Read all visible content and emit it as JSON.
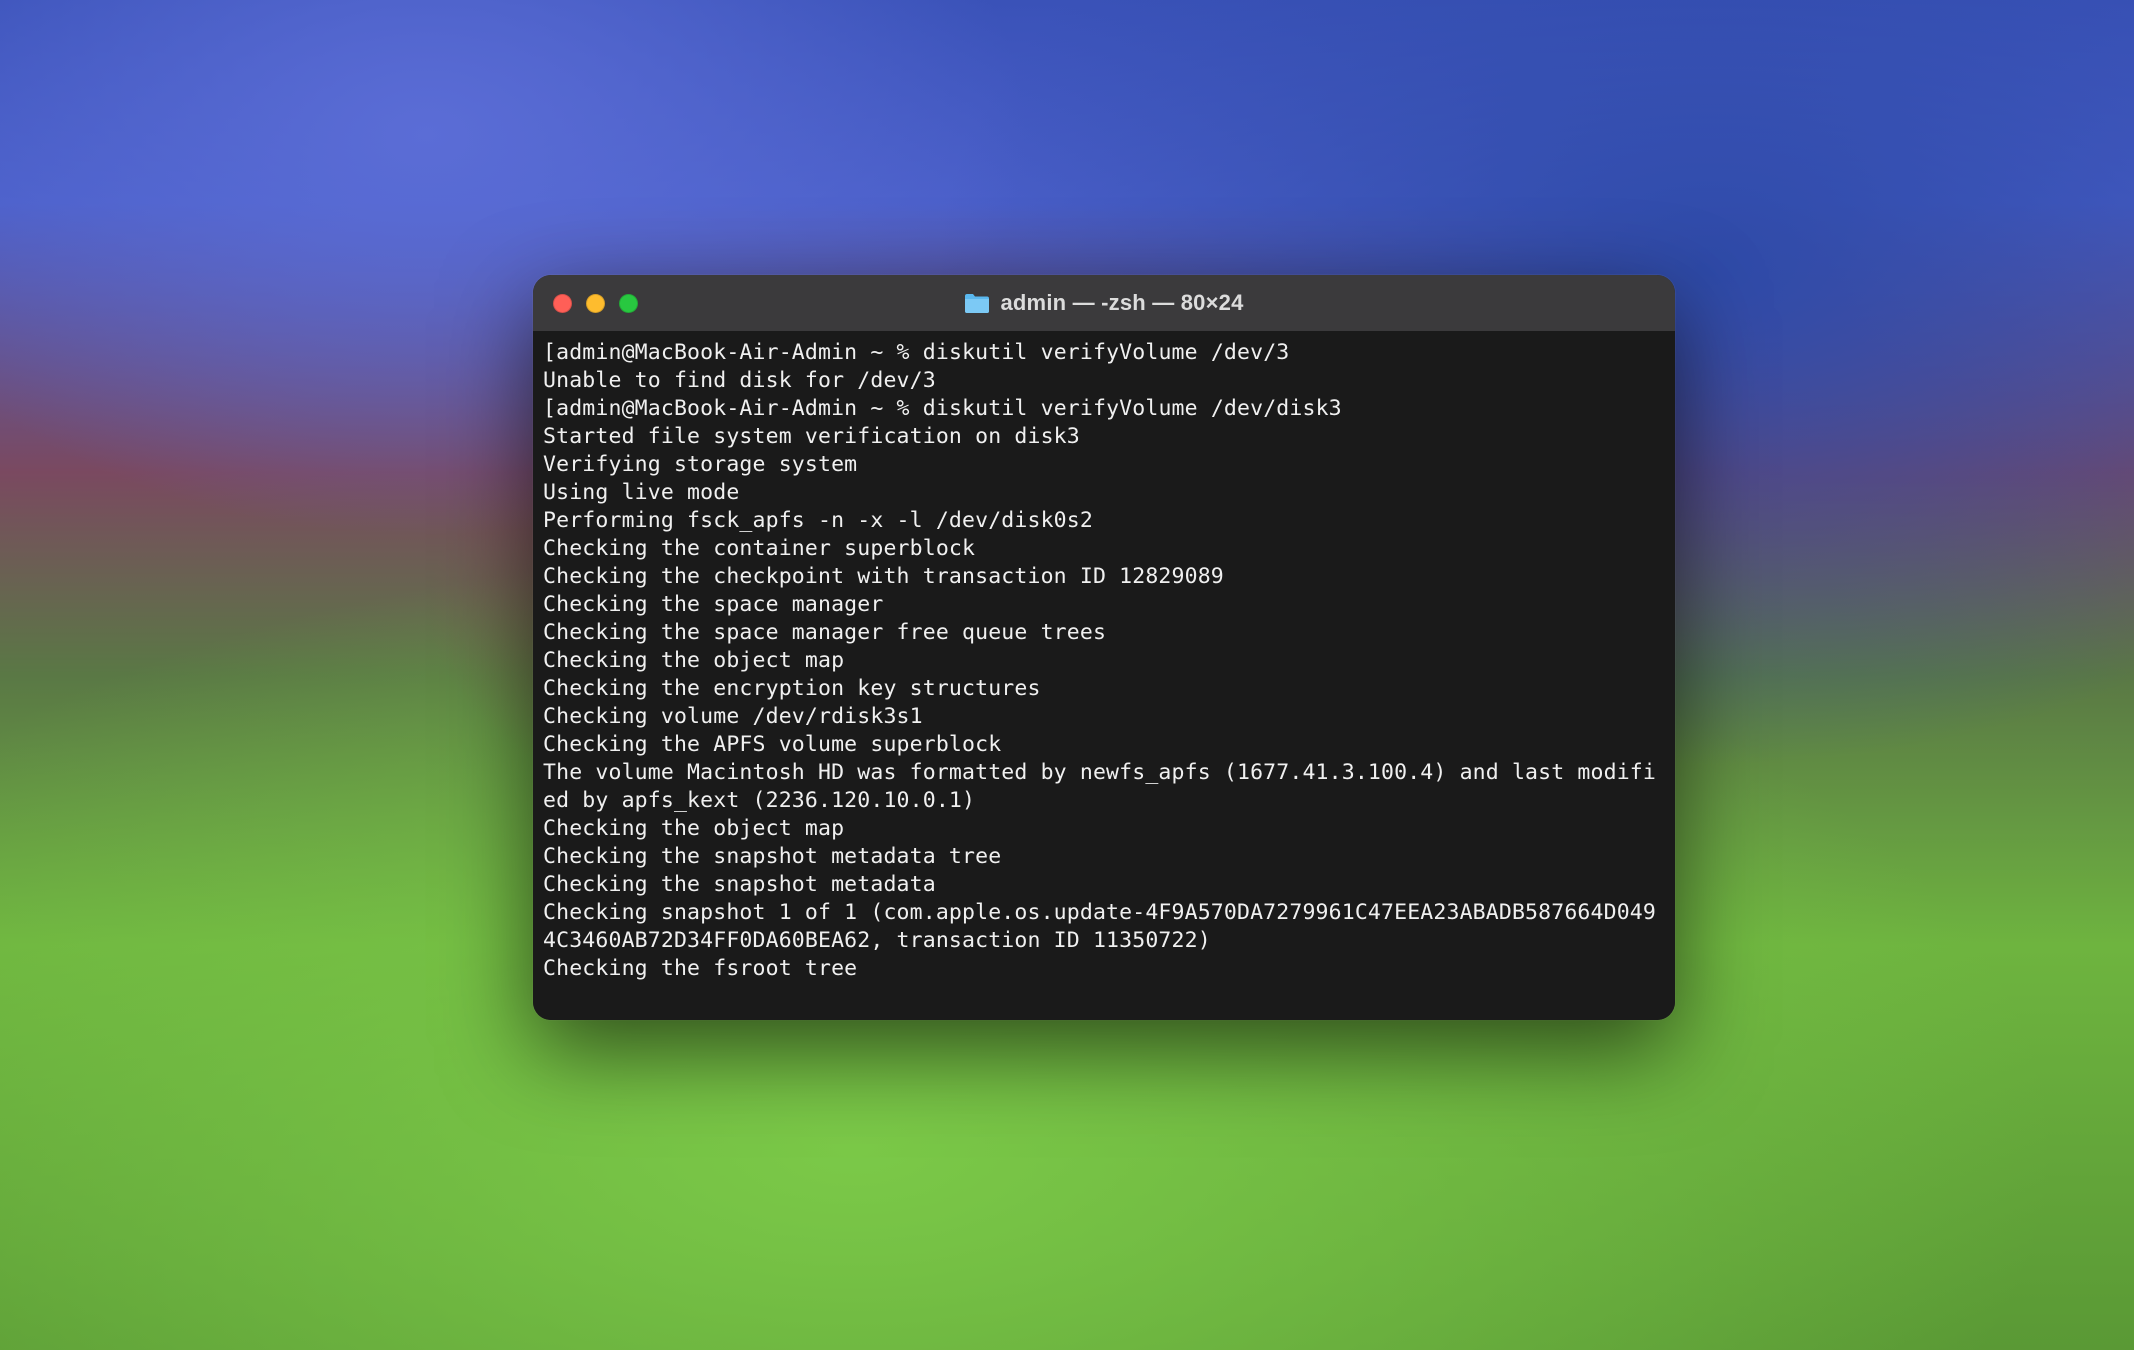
{
  "window": {
    "title": "admin — -zsh — 80×24"
  },
  "terminal": {
    "prompts": [
      {
        "prefix": "[",
        "prompt": "admin@MacBook-Air-Admin ~ % ",
        "command": "diskutil verifyVolume /dev/3",
        "suffix": "]"
      },
      {
        "prefix": "[",
        "prompt": "admin@MacBook-Air-Admin ~ % ",
        "command": "diskutil verifyVolume /dev/disk3",
        "suffix": "]"
      }
    ],
    "output1": "Unable to find disk for /dev/3",
    "output2": [
      "Started file system verification on disk3",
      "Verifying storage system",
      "Using live mode",
      "Performing fsck_apfs -n -x -l /dev/disk0s2",
      "Checking the container superblock",
      "Checking the checkpoint with transaction ID 12829089",
      "Checking the space manager",
      "Checking the space manager free queue trees",
      "Checking the object map",
      "Checking the encryption key structures",
      "Checking volume /dev/rdisk3s1",
      "Checking the APFS volume superblock",
      "The volume Macintosh HD was formatted by newfs_apfs (1677.41.3.100.4) and last modified by apfs_kext (2236.120.10.0.1)",
      "Checking the object map",
      "Checking the snapshot metadata tree",
      "Checking the snapshot metadata",
      "Checking snapshot 1 of 1 (com.apple.os.update-4F9A570DA7279961C47EEA23ABADB587664D0494C3460AB72D34FF0DA60BEA62, transaction ID 11350722)",
      "Checking the fsroot tree"
    ]
  }
}
